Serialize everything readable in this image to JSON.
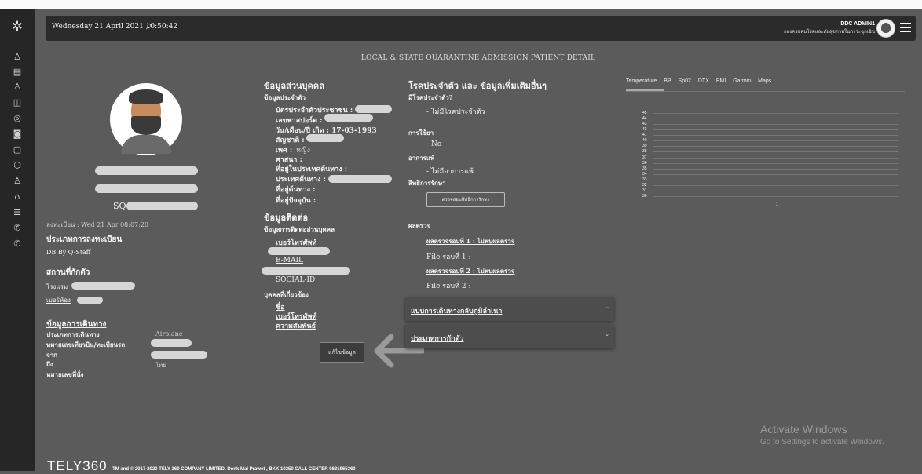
{
  "header": {
    "datetime": "Wednesday 21 April 2021 10:50:42",
    "user_name": "DDC ADMIN1",
    "user_org": "กองควบคุมโรคและภัยสุขภาพในภาวะฉุกเฉิน"
  },
  "page_title": "LOCAL & STATE QUARANTINE ADMISSION PATIENT DETAIL",
  "profile": {
    "id_prefix": "SQ-",
    "registered": "ลงทะเบียน : Wed 21 Apr 08:07:20",
    "reg_type_heading": "ประเภทการลงทะเบียน",
    "reg_type_value": "DB By Q-Staff",
    "quarantine_heading": "สถานที่กักตัว",
    "hotel_label": "โรงแรม",
    "room_label": "เบอร์ห้อง",
    "travel_heading": "ข้อมูลการเดินทาง",
    "travel_type_label": "ประเภทการเดินทาง",
    "travel_type_value": "Airplane",
    "flight_label": "หมายเลขเที่ยวบิน/ทะเบียนรถ",
    "from_label": "จาก",
    "to_label": "ถึง",
    "to_value": "ไทย",
    "seat_label": "หมายเลขที่นั่ง"
  },
  "personal": {
    "heading": "ข้อมูลส่วนบุคคล",
    "sub": "ข้อมูลประจำตัว",
    "id_card": "บัตรประจำตัวประชาชน :",
    "passport": "เลขพาสปอร์ต :",
    "dob": "วัน/เดือน/ปี เกิด : 17-03-1993",
    "nationality": "สัญชาติ :",
    "gender": "เพศ :",
    "gender_value": "หญิง",
    "religion": "ศาสนา :",
    "origin_addr": "ที่อยู่ในประเทศต้นทาง :",
    "origin_country": "ประเทศต้นทาง :",
    "dest_addr": "ที่อยู่ต้นทาง :",
    "current_addr": "ที่อยู่ปัจจุบัน :",
    "contact_heading": "ข้อมูลติดต่อ",
    "contact_sub": "ข้อมูลการติดต่อส่วนบุคคล",
    "phone": "เบอร์โทรศัพท์",
    "email": "E-MAIL",
    "social": "SOCIAL-ID",
    "related_sub": "บุคคลที่เกี่ยวข้อง",
    "rel_name": "ชื่อ",
    "rel_phone": "เบอร์โทรศัพท์",
    "rel_relation": "ความสัมพันธ์",
    "edit_button": "แก้ไขข้อมูล"
  },
  "medical": {
    "heading": "โรคประจำตัว และ ข้อมูลเพิ่มเติมอื่นๆ",
    "disease_q": "มีโรคประจำตัว?",
    "disease_a": "- ไม่มีโรคประจำตัว",
    "medicine_q": "การใช้ยา",
    "medicine_a": "- No",
    "allergy_q": "อาการแพ้",
    "allergy_a": "- ไม่มีอาการแพ้",
    "rights_q": "สิทธิการรักษา",
    "rights_button": "ตรวจสอบสิทธิการรักษา",
    "results_q": "ผลตรวจ",
    "result1": "ผลตรวจรอบที่ 1 : ไม่พบผลตรวจ",
    "file1": "File รอบที่ 1 :",
    "result2": "ผลตรวจรอบที่ 2 : ไม่พบผลตรวจ",
    "file2": "File รอบที่ 2 :",
    "accordion1": "แบบการเดินทางกลับภูมิลำเนา",
    "accordion2": "ประเภทการกักตัว"
  },
  "vitals": {
    "tabs": [
      "Temperature",
      "BP",
      "Sp02",
      "DTX",
      "BMI",
      "Garmin",
      "Maps"
    ],
    "active_tab": "Temperature"
  },
  "chart_data": {
    "type": "line",
    "title": "",
    "xlabel": "",
    "ylabel": "",
    "y_ticks": [
      45,
      44,
      43,
      42,
      41,
      40,
      39,
      38,
      37,
      36,
      35,
      34,
      33,
      32,
      31,
      30
    ],
    "ylim": [
      30,
      45
    ],
    "x_ticks": [
      "1"
    ],
    "series": [],
    "grid": true
  },
  "watermark": {
    "line1": "Activate Windows",
    "line2": "Go to Settings to activate Windows."
  },
  "footer": {
    "logo": "TELY360",
    "copyright": "TM and © 2017-2020 TELY 360 COMPANY LIMITED. Donk Mai Prawet , BKK 10250 CALL CENTER 0631965360"
  },
  "sidebar_icons": [
    "users-icon",
    "document-icon",
    "users-icon",
    "map-icon",
    "location-icon",
    "camera-icon",
    "clipboard-icon",
    "cube-icon",
    "user-icon",
    "home-icon",
    "server-icon",
    "phone-icon",
    "phone-call-icon"
  ]
}
